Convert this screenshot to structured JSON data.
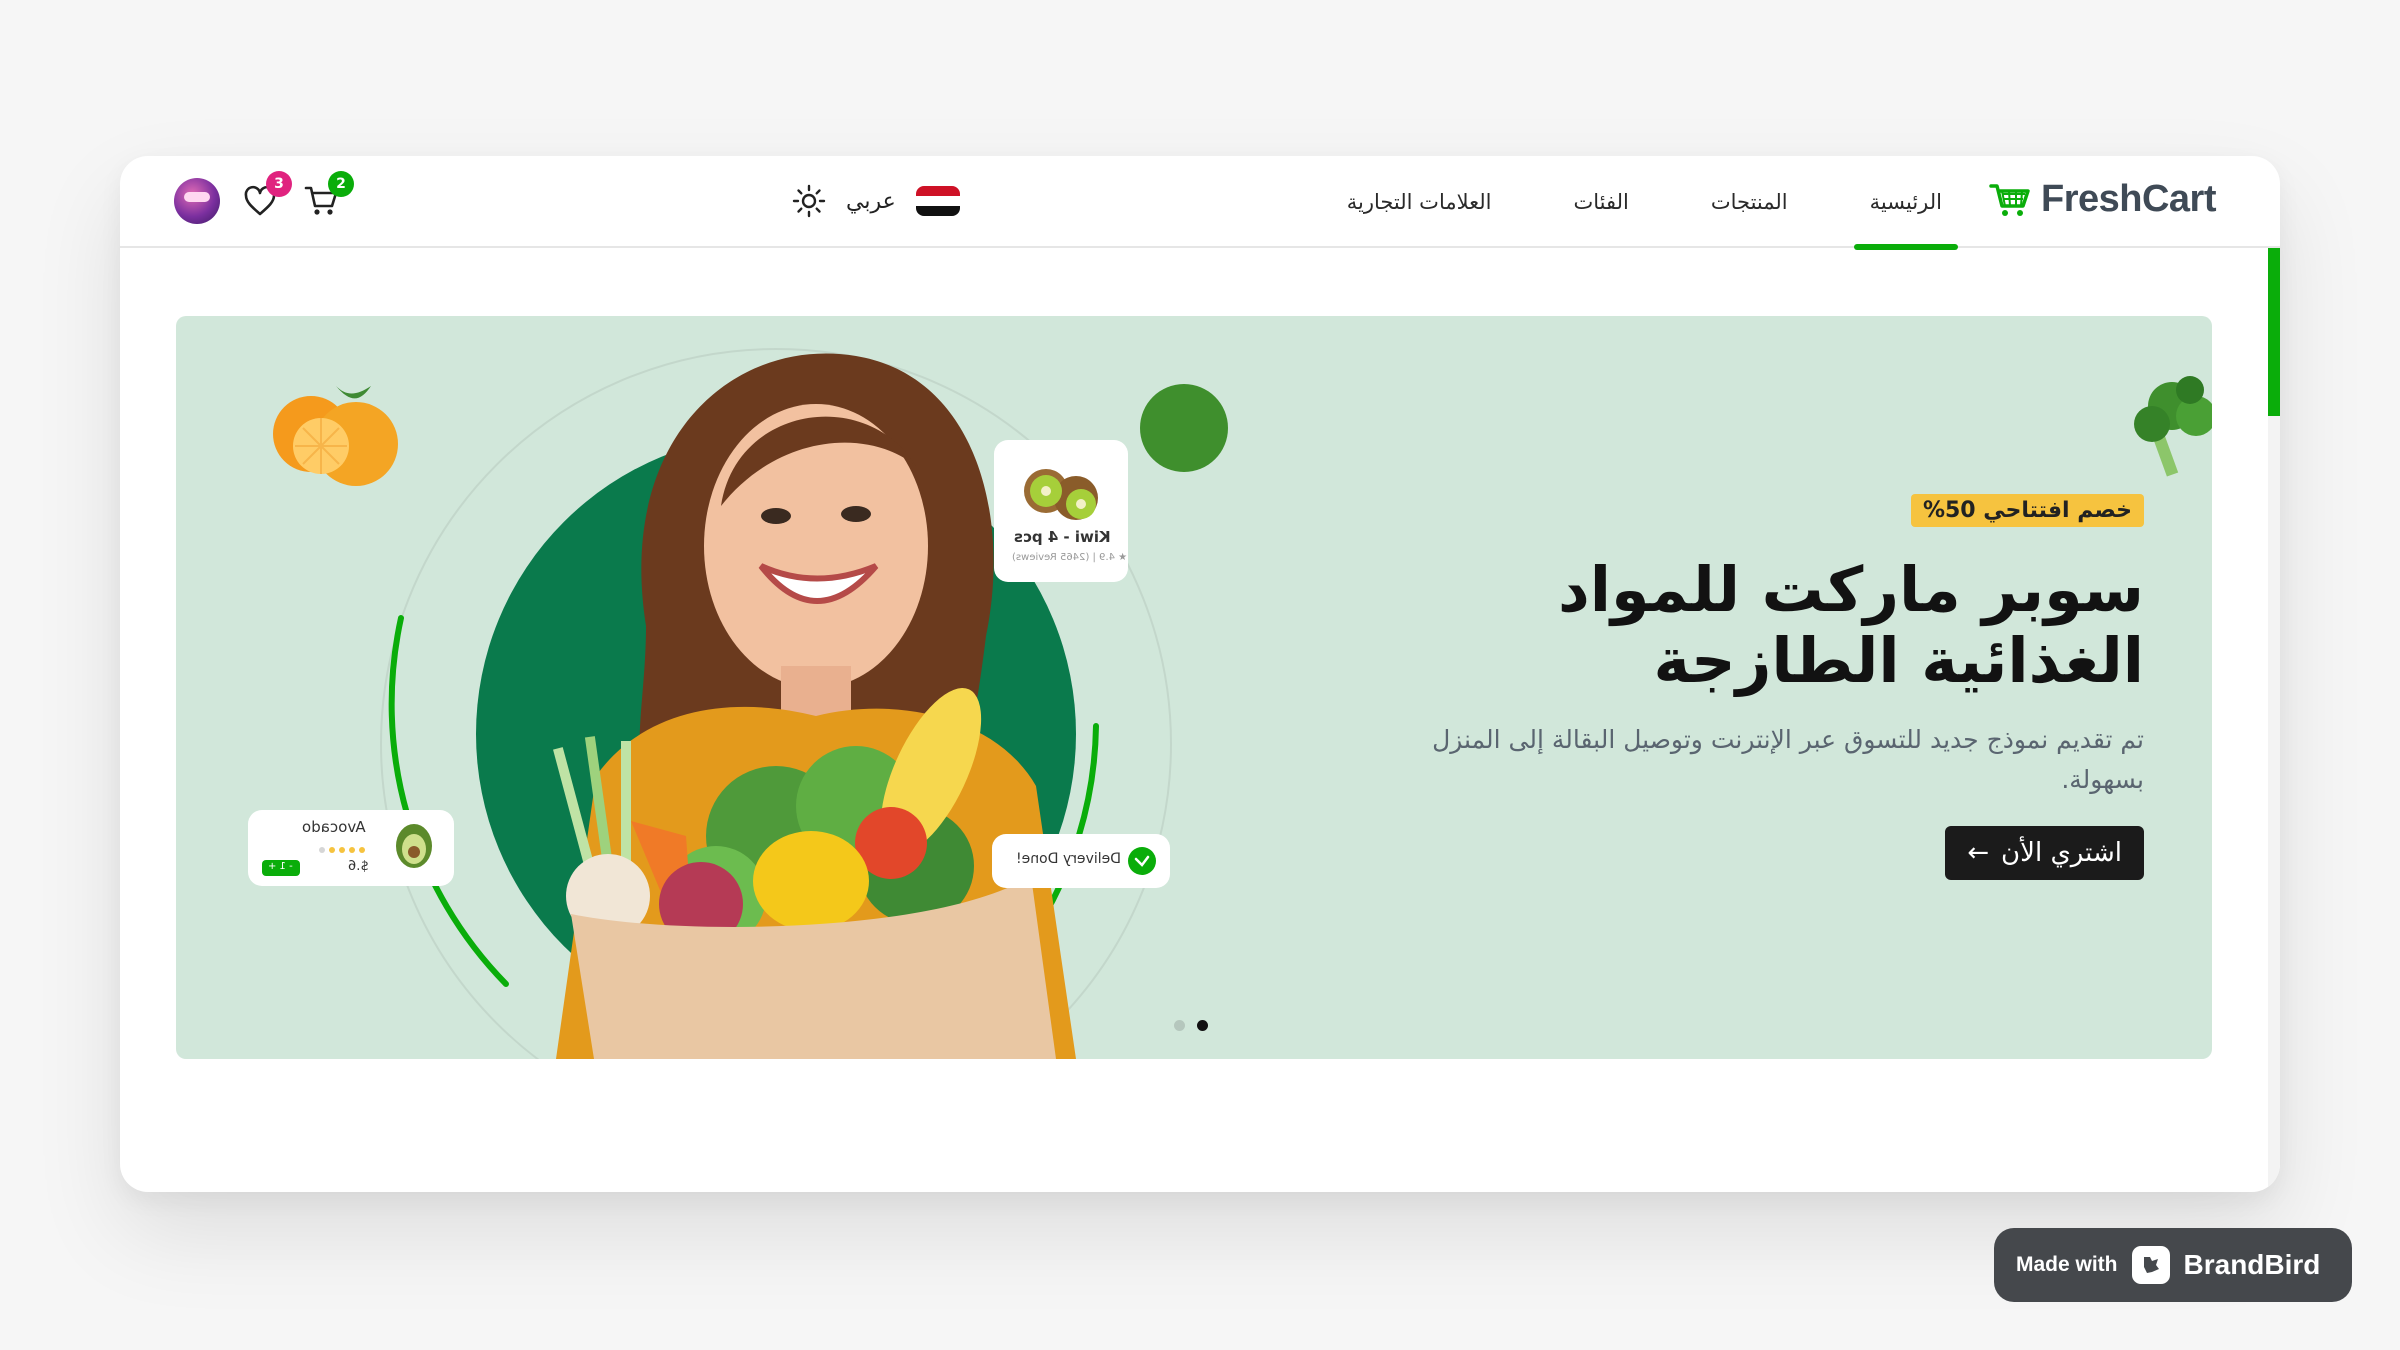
{
  "navbar": {
    "brand": "FreshCart",
    "links": [
      {
        "label": "الرئيسية",
        "active": true
      },
      {
        "label": "المنتجات",
        "active": false
      },
      {
        "label": "الفئات",
        "active": false
      },
      {
        "label": "العلامات التجارية",
        "active": false
      }
    ],
    "language": {
      "label": "عربي",
      "flag": "egypt-flag-icon"
    },
    "theme_icon": "sun-icon",
    "wishlist_count": "3",
    "cart_count": "2"
  },
  "hero": {
    "badge": "خصم افتتاحي 50%",
    "title_line1": "سوبر ماركت للمواد",
    "title_line2": "الغذائية الطازجة",
    "description": "تم تقديم نموذج جديد للتسوق عبر الإنترنت وتوصيل البقالة إلى المنزل بسهولة.",
    "cta_label": "اشتري الأن",
    "cta_arrow": "←",
    "cards": {
      "kiwi": "Kiwi - 4 pcs",
      "kiwi_meta": "★ 4.9 | (2465 Reviews)",
      "delivery": "Delivery Done!",
      "avocado": "Avocado",
      "avocado_price": "$.6",
      "avocado_qty": "- 1 +"
    },
    "slides": 2,
    "active_slide": 2
  },
  "branding": {
    "made_with": "Made with",
    "brand": "BrandBird"
  },
  "colors": {
    "accent": "#0aad0a",
    "hero_bg": "#d1e7da",
    "badge": "#f6c33f",
    "dark": "#1b1b1b"
  }
}
